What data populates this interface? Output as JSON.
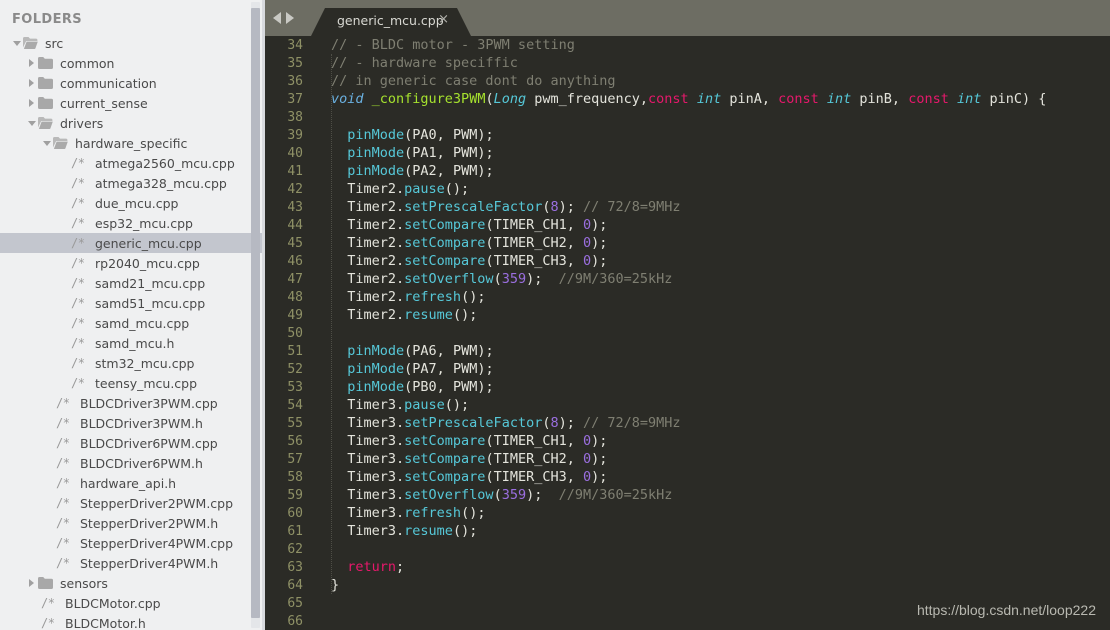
{
  "sidebar": {
    "title": "FOLDERS",
    "items": [
      {
        "label": "src",
        "type": "folder",
        "state": "open",
        "depth": 0
      },
      {
        "label": "common",
        "type": "folder",
        "state": "closed",
        "depth": 1
      },
      {
        "label": "communication",
        "type": "folder",
        "state": "closed",
        "depth": 1
      },
      {
        "label": "current_sense",
        "type": "folder",
        "state": "closed",
        "depth": 1
      },
      {
        "label": "drivers",
        "type": "folder",
        "state": "open",
        "depth": 1
      },
      {
        "label": "hardware_specific",
        "type": "folder",
        "state": "open",
        "depth": 2
      },
      {
        "label": "atmega2560_mcu.cpp",
        "type": "file",
        "depth": 3
      },
      {
        "label": "atmega328_mcu.cpp",
        "type": "file",
        "depth": 3
      },
      {
        "label": "due_mcu.cpp",
        "type": "file",
        "depth": 3
      },
      {
        "label": "esp32_mcu.cpp",
        "type": "file",
        "depth": 3
      },
      {
        "label": "generic_mcu.cpp",
        "type": "file",
        "depth": 3,
        "selected": true
      },
      {
        "label": "rp2040_mcu.cpp",
        "type": "file",
        "depth": 3
      },
      {
        "label": "samd21_mcu.cpp",
        "type": "file",
        "depth": 3
      },
      {
        "label": "samd51_mcu.cpp",
        "type": "file",
        "depth": 3
      },
      {
        "label": "samd_mcu.cpp",
        "type": "file",
        "depth": 3
      },
      {
        "label": "samd_mcu.h",
        "type": "file",
        "depth": 3
      },
      {
        "label": "stm32_mcu.cpp",
        "type": "file",
        "depth": 3
      },
      {
        "label": "teensy_mcu.cpp",
        "type": "file",
        "depth": 3
      },
      {
        "label": "BLDCDriver3PWM.cpp",
        "type": "file",
        "depth": 2
      },
      {
        "label": "BLDCDriver3PWM.h",
        "type": "file",
        "depth": 2
      },
      {
        "label": "BLDCDriver6PWM.cpp",
        "type": "file",
        "depth": 2
      },
      {
        "label": "BLDCDriver6PWM.h",
        "type": "file",
        "depth": 2
      },
      {
        "label": "hardware_api.h",
        "type": "file",
        "depth": 2
      },
      {
        "label": "StepperDriver2PWM.cpp",
        "type": "file",
        "depth": 2
      },
      {
        "label": "StepperDriver2PWM.h",
        "type": "file",
        "depth": 2
      },
      {
        "label": "StepperDriver4PWM.cpp",
        "type": "file",
        "depth": 2
      },
      {
        "label": "StepperDriver4PWM.h",
        "type": "file",
        "depth": 2
      },
      {
        "label": "sensors",
        "type": "folder",
        "state": "closed",
        "depth": 1
      },
      {
        "label": "BLDCMotor.cpp",
        "type": "file",
        "depth": 1
      },
      {
        "label": "BLDCMotor.h",
        "type": "file",
        "depth": 1
      }
    ],
    "file_icon_glyph": "/*"
  },
  "tabbar": {
    "nav_back": "◀",
    "nav_forward": "▶",
    "tab_label": "generic_mcu.cpp",
    "close_glyph": "×"
  },
  "editor": {
    "first_line_number": 34,
    "lines": [
      {
        "n": 34,
        "tokens": [
          {
            "t": "// - BLDC motor - 3PWM setting",
            "c": "c-com"
          }
        ]
      },
      {
        "n": 35,
        "tokens": [
          {
            "t": "// - hardware speciffic",
            "c": "c-com"
          }
        ]
      },
      {
        "n": 36,
        "tokens": [
          {
            "t": "// in generic case dont do anything",
            "c": "c-com"
          }
        ]
      },
      {
        "n": 37,
        "tokens": [
          {
            "t": "void",
            "c": "c-kw2"
          },
          {
            "t": " ",
            "c": "c-pl"
          },
          {
            "t": "_configure3PWM",
            "c": "c-fn"
          },
          {
            "t": "(",
            "c": "c-pl"
          },
          {
            "t": "Long",
            "c": "c-typ"
          },
          {
            "t": " pwm_frequency,",
            "c": "c-pl"
          },
          {
            "t": "const",
            "c": "c-kw"
          },
          {
            "t": " ",
            "c": "c-pl"
          },
          {
            "t": "int",
            "c": "c-typ"
          },
          {
            "t": " pinA, ",
            "c": "c-pl"
          },
          {
            "t": "const",
            "c": "c-kw"
          },
          {
            "t": " ",
            "c": "c-pl"
          },
          {
            "t": "int",
            "c": "c-typ"
          },
          {
            "t": " pinB, ",
            "c": "c-pl"
          },
          {
            "t": "const",
            "c": "c-kw"
          },
          {
            "t": " ",
            "c": "c-pl"
          },
          {
            "t": "int",
            "c": "c-typ"
          },
          {
            "t": " pinC) {",
            "c": "c-pl"
          }
        ]
      },
      {
        "n": 38,
        "tokens": []
      },
      {
        "n": 39,
        "tokens": [
          {
            "t": "  ",
            "c": "c-pl"
          },
          {
            "t": "pinMode",
            "c": "c-meth"
          },
          {
            "t": "(PA0, PWM);",
            "c": "c-pl"
          }
        ]
      },
      {
        "n": 40,
        "tokens": [
          {
            "t": "  ",
            "c": "c-pl"
          },
          {
            "t": "pinMode",
            "c": "c-meth"
          },
          {
            "t": "(PA1, PWM);",
            "c": "c-pl"
          }
        ]
      },
      {
        "n": 41,
        "tokens": [
          {
            "t": "  ",
            "c": "c-pl"
          },
          {
            "t": "pinMode",
            "c": "c-meth"
          },
          {
            "t": "(PA2, PWM);",
            "c": "c-pl"
          }
        ]
      },
      {
        "n": 42,
        "tokens": [
          {
            "t": "  Timer2.",
            "c": "c-pl"
          },
          {
            "t": "pause",
            "c": "c-meth"
          },
          {
            "t": "();",
            "c": "c-pl"
          }
        ]
      },
      {
        "n": 43,
        "tokens": [
          {
            "t": "  Timer2.",
            "c": "c-pl"
          },
          {
            "t": "setPrescaleFactor",
            "c": "c-meth"
          },
          {
            "t": "(",
            "c": "c-pl"
          },
          {
            "t": "8",
            "c": "c-num"
          },
          {
            "t": "); ",
            "c": "c-pl"
          },
          {
            "t": "// 72/8=9MHz",
            "c": "c-com"
          }
        ]
      },
      {
        "n": 44,
        "tokens": [
          {
            "t": "  Timer2.",
            "c": "c-pl"
          },
          {
            "t": "setCompare",
            "c": "c-meth"
          },
          {
            "t": "(TIMER_CH1, ",
            "c": "c-pl"
          },
          {
            "t": "0",
            "c": "c-num"
          },
          {
            "t": ");",
            "c": "c-pl"
          }
        ]
      },
      {
        "n": 45,
        "tokens": [
          {
            "t": "  Timer2.",
            "c": "c-pl"
          },
          {
            "t": "setCompare",
            "c": "c-meth"
          },
          {
            "t": "(TIMER_CH2, ",
            "c": "c-pl"
          },
          {
            "t": "0",
            "c": "c-num"
          },
          {
            "t": ");",
            "c": "c-pl"
          }
        ]
      },
      {
        "n": 46,
        "tokens": [
          {
            "t": "  Timer2.",
            "c": "c-pl"
          },
          {
            "t": "setCompare",
            "c": "c-meth"
          },
          {
            "t": "(TIMER_CH3, ",
            "c": "c-pl"
          },
          {
            "t": "0",
            "c": "c-num"
          },
          {
            "t": ");",
            "c": "c-pl"
          }
        ]
      },
      {
        "n": 47,
        "tokens": [
          {
            "t": "  Timer2.",
            "c": "c-pl"
          },
          {
            "t": "setOverflow",
            "c": "c-meth"
          },
          {
            "t": "(",
            "c": "c-pl"
          },
          {
            "t": "359",
            "c": "c-num"
          },
          {
            "t": ");  ",
            "c": "c-pl"
          },
          {
            "t": "//9M/360=25kHz",
            "c": "c-com"
          }
        ]
      },
      {
        "n": 48,
        "tokens": [
          {
            "t": "  Timer2.",
            "c": "c-pl"
          },
          {
            "t": "refresh",
            "c": "c-meth"
          },
          {
            "t": "();",
            "c": "c-pl"
          }
        ]
      },
      {
        "n": 49,
        "tokens": [
          {
            "t": "  Timer2.",
            "c": "c-pl"
          },
          {
            "t": "resume",
            "c": "c-meth"
          },
          {
            "t": "();",
            "c": "c-pl"
          }
        ]
      },
      {
        "n": 50,
        "tokens": []
      },
      {
        "n": 51,
        "tokens": [
          {
            "t": "  ",
            "c": "c-pl"
          },
          {
            "t": "pinMode",
            "c": "c-meth"
          },
          {
            "t": "(PA6, PWM);",
            "c": "c-pl"
          }
        ]
      },
      {
        "n": 52,
        "tokens": [
          {
            "t": "  ",
            "c": "c-pl"
          },
          {
            "t": "pinMode",
            "c": "c-meth"
          },
          {
            "t": "(PA7, PWM);",
            "c": "c-pl"
          }
        ]
      },
      {
        "n": 53,
        "tokens": [
          {
            "t": "  ",
            "c": "c-pl"
          },
          {
            "t": "pinMode",
            "c": "c-meth"
          },
          {
            "t": "(PB0, PWM);",
            "c": "c-pl"
          }
        ]
      },
      {
        "n": 54,
        "tokens": [
          {
            "t": "  Timer3.",
            "c": "c-pl"
          },
          {
            "t": "pause",
            "c": "c-meth"
          },
          {
            "t": "();",
            "c": "c-pl"
          }
        ]
      },
      {
        "n": 55,
        "tokens": [
          {
            "t": "  Timer3.",
            "c": "c-pl"
          },
          {
            "t": "setPrescaleFactor",
            "c": "c-meth"
          },
          {
            "t": "(",
            "c": "c-pl"
          },
          {
            "t": "8",
            "c": "c-num"
          },
          {
            "t": "); ",
            "c": "c-pl"
          },
          {
            "t": "// 72/8=9MHz",
            "c": "c-com"
          }
        ]
      },
      {
        "n": 56,
        "tokens": [
          {
            "t": "  Timer3.",
            "c": "c-pl"
          },
          {
            "t": "setCompare",
            "c": "c-meth"
          },
          {
            "t": "(TIMER_CH1, ",
            "c": "c-pl"
          },
          {
            "t": "0",
            "c": "c-num"
          },
          {
            "t": ");",
            "c": "c-pl"
          }
        ]
      },
      {
        "n": 57,
        "tokens": [
          {
            "t": "  Timer3.",
            "c": "c-pl"
          },
          {
            "t": "setCompare",
            "c": "c-meth"
          },
          {
            "t": "(TIMER_CH2, ",
            "c": "c-pl"
          },
          {
            "t": "0",
            "c": "c-num"
          },
          {
            "t": ");",
            "c": "c-pl"
          }
        ]
      },
      {
        "n": 58,
        "tokens": [
          {
            "t": "  Timer3.",
            "c": "c-pl"
          },
          {
            "t": "setCompare",
            "c": "c-meth"
          },
          {
            "t": "(TIMER_CH3, ",
            "c": "c-pl"
          },
          {
            "t": "0",
            "c": "c-num"
          },
          {
            "t": ");",
            "c": "c-pl"
          }
        ]
      },
      {
        "n": 59,
        "tokens": [
          {
            "t": "  Timer3.",
            "c": "c-pl"
          },
          {
            "t": "setOverflow",
            "c": "c-meth"
          },
          {
            "t": "(",
            "c": "c-pl"
          },
          {
            "t": "359",
            "c": "c-num"
          },
          {
            "t": ");  ",
            "c": "c-pl"
          },
          {
            "t": "//9M/360=25kHz",
            "c": "c-com"
          }
        ]
      },
      {
        "n": 60,
        "tokens": [
          {
            "t": "  Timer3.",
            "c": "c-pl"
          },
          {
            "t": "refresh",
            "c": "c-meth"
          },
          {
            "t": "();",
            "c": "c-pl"
          }
        ]
      },
      {
        "n": 61,
        "tokens": [
          {
            "t": "  Timer3.",
            "c": "c-pl"
          },
          {
            "t": "resume",
            "c": "c-meth"
          },
          {
            "t": "();",
            "c": "c-pl"
          }
        ]
      },
      {
        "n": 62,
        "tokens": []
      },
      {
        "n": 63,
        "tokens": [
          {
            "t": "  ",
            "c": "c-pl"
          },
          {
            "t": "return",
            "c": "c-kw"
          },
          {
            "t": ";",
            "c": "c-pl"
          }
        ]
      },
      {
        "n": 64,
        "tokens": [
          {
            "t": "}",
            "c": "c-pl"
          }
        ]
      },
      {
        "n": 65,
        "tokens": []
      },
      {
        "n": 66,
        "tokens": []
      }
    ]
  },
  "watermark": "https://blog.csdn.net/loop222",
  "colors": {
    "sidebar_bg": "#eff0f1",
    "editor_bg": "#2b2b26",
    "tabbar_bg": "#6d6d63",
    "selection_bg": "#c3c6ce",
    "gutter_fg": "#8f9166",
    "comment": "#7f7f72",
    "keyword": "#e6186b",
    "type": "#56c8d8",
    "function": "#a6e22e",
    "number": "#9b6fe0",
    "plain": "#e4e4dc"
  }
}
